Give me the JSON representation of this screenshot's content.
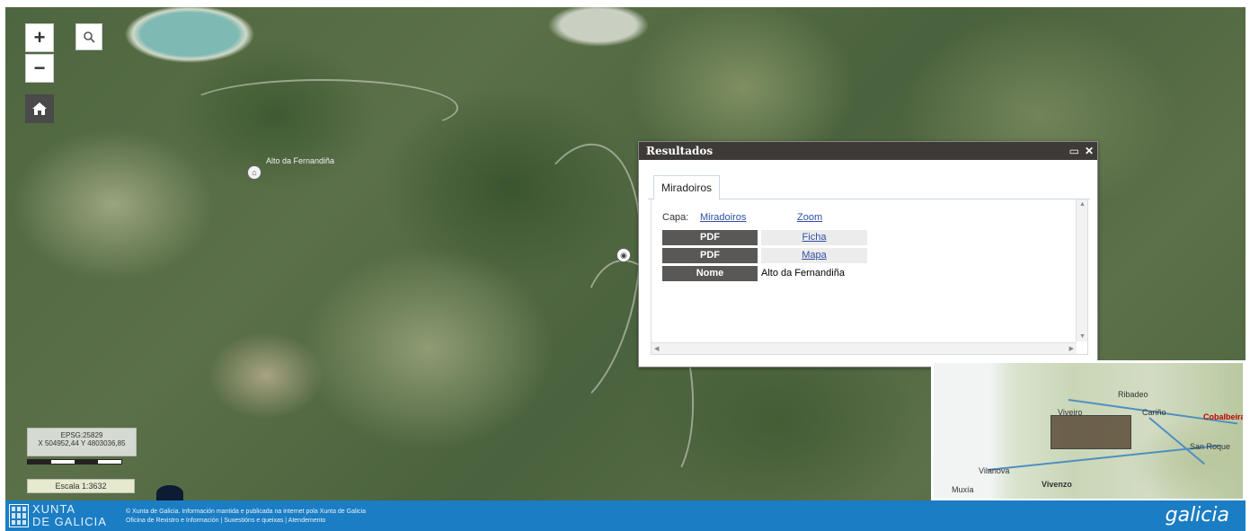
{
  "map": {
    "controls": {
      "zoom_in": "+",
      "zoom_out": "−",
      "search_icon": "search-icon",
      "home_icon": "home-icon"
    },
    "poi_label": "Alto da Fernandiña",
    "scale": {
      "projection": "EPSG:25829",
      "coords": "X 504952,44 Y 4803036,85",
      "scale_text": "Escala 1:3632"
    }
  },
  "popup": {
    "title": "Resultados",
    "maximize_icon": "maximize-icon",
    "close_icon": "close-icon",
    "tab": "Miradoiros",
    "capa_label": "Capa:",
    "capa_link": "Miradoiros",
    "zoom_link": "Zoom",
    "rows": [
      {
        "label": "PDF",
        "value": "Ficha",
        "link": true
      },
      {
        "label": "PDF",
        "value": "Mapa",
        "link": true
      },
      {
        "label": "Nome",
        "value": "Alto da Fernandiña",
        "link": false
      }
    ]
  },
  "overview": {
    "labels": [
      "Ribadeo",
      "Viveiro",
      "Cariño",
      "Cobalbeira",
      "San Roque",
      "Vilanova",
      "Vivenzo",
      "Muxía"
    ]
  },
  "footer": {
    "org_line1": "XUNTA",
    "org_line2": "DE GALICIA",
    "info_line1": "© Xunta de Galicia. Información mantida e publicada na internet pola Xunta de Galicia",
    "info_line2": "Oficina de Rexistro e Información | Suxestións e queixas | Atendemento",
    "brand": "galicia"
  }
}
